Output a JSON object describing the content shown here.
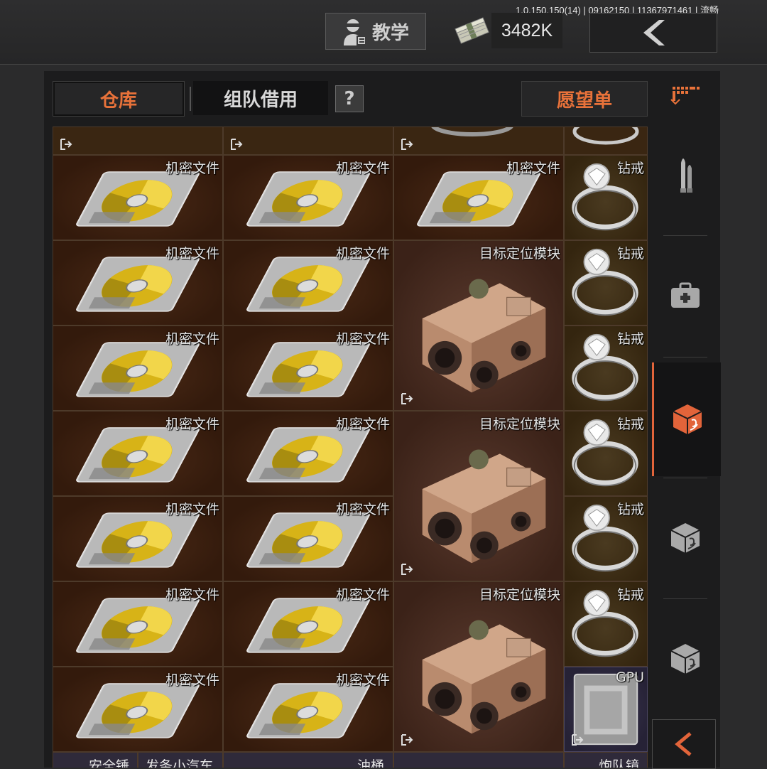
{
  "header": {
    "version": "1.0.150.150(14) | 09162150 | 11367971461 | 流畅",
    "tutorial_label": "教学",
    "money": "3482K"
  },
  "tabs": {
    "warehouse": "仓库",
    "team_borrow": "组队借用",
    "help": "?",
    "wishlist": "愿望单"
  },
  "grid": {
    "rows": [
      [
        "机密文件",
        "机密文件",
        "机密文件",
        "钻戒"
      ],
      [
        "机密文件",
        "机密文件",
        "目标定位模块",
        "钻戒"
      ],
      [
        "机密文件",
        "机密文件",
        "",
        "钻戒"
      ],
      [
        "机密文件",
        "机密文件",
        "目标定位模块",
        "钻戒"
      ],
      [
        "机密文件",
        "机密文件",
        "",
        "钻戒"
      ],
      [
        "机密文件",
        "机密文件",
        "目标定位模块",
        "钻戒"
      ],
      [
        "机密文件",
        "机密文件",
        "",
        "GPU"
      ]
    ],
    "bottom_row": [
      "安全锤",
      "发条小汽车",
      "油桶",
      "",
      "炮队镜"
    ]
  },
  "colors": {
    "accent": "#e8723a",
    "cell_bg": "#3b1f10",
    "panel_bg": "#1c1c1d"
  },
  "icons": {
    "nav": [
      "inventory-grid-icon",
      "ammo-icon",
      "medkit-icon",
      "armor-case-icon",
      "armor-case-icon",
      "armor-case-icon"
    ]
  }
}
